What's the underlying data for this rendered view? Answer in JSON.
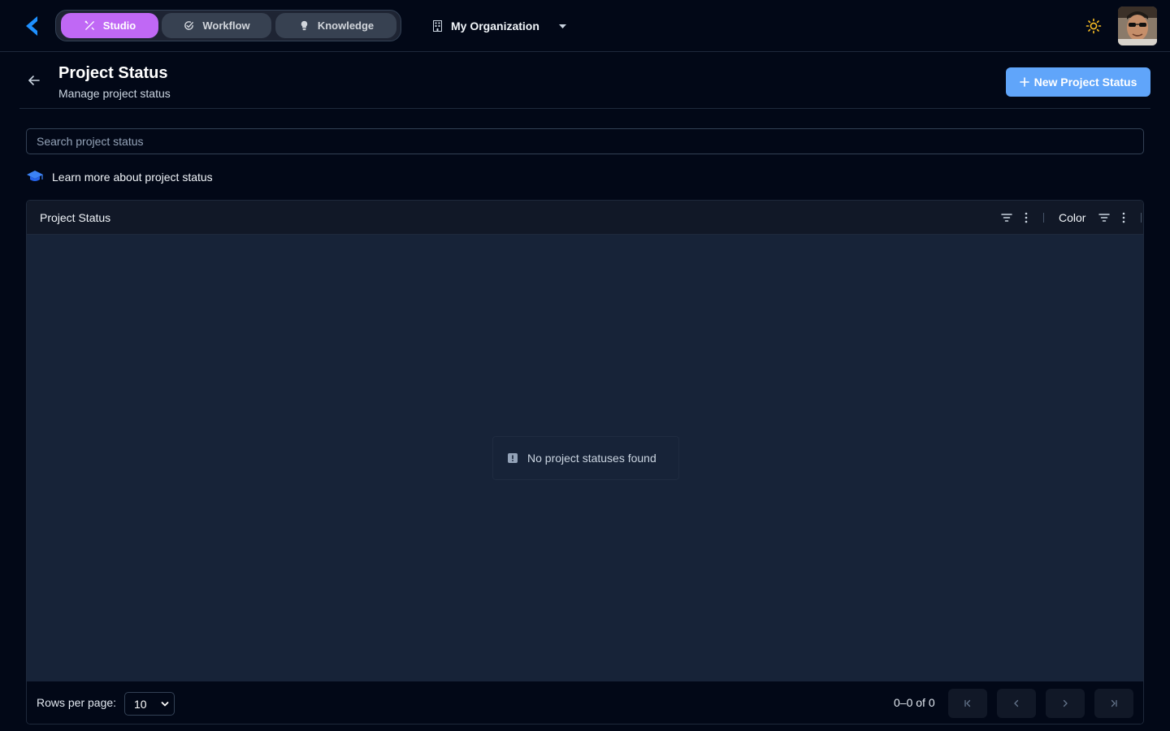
{
  "nav": {
    "modes": [
      {
        "label": "Studio",
        "icon": "magic-wand-icon",
        "active": true
      },
      {
        "label": "Workflow",
        "icon": "check-circle-icon",
        "active": false
      },
      {
        "label": "Knowledge",
        "icon": "lightbulb-icon",
        "active": false
      }
    ],
    "organization": "My Organization"
  },
  "header": {
    "title": "Project Status",
    "subtitle": "Manage project status",
    "new_button_label": "New Project Status"
  },
  "search": {
    "placeholder": "Search project status",
    "value": ""
  },
  "learn_more": "Learn more about project status",
  "table": {
    "columns": [
      "Project Status",
      "Color"
    ],
    "rows": [],
    "empty_message": "No project statuses found"
  },
  "pagination": {
    "rows_per_page_label": "Rows per page:",
    "rows_per_page": "10",
    "range": "0–0 of 0"
  },
  "colors": {
    "background": "#020817",
    "accent_purple": "#c068f5",
    "primary_button": "#60a5fa",
    "table_body": "#172338",
    "logo_blue": "#1e90ff"
  }
}
